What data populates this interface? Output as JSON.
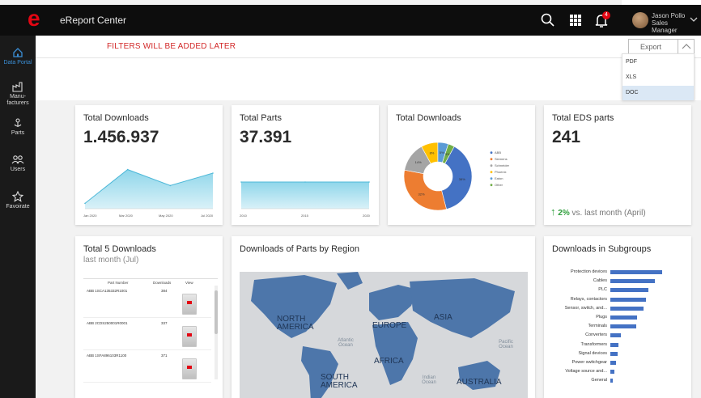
{
  "app": {
    "logo_letter": "e",
    "title": "eReport Center"
  },
  "header": {
    "notification_count": "4",
    "user_name": "Jason Pollo",
    "user_role": "Sales Manager"
  },
  "sidebar": {
    "items": [
      {
        "label": "Data Portal",
        "icon": "home-icon",
        "active": true
      },
      {
        "label": "Manu-facturers",
        "icon": "factory-icon",
        "active": false
      },
      {
        "label": "Parts",
        "icon": "parts-icon",
        "active": false
      },
      {
        "label": "Users",
        "icon": "users-icon",
        "active": false
      },
      {
        "label": "Favoirate",
        "icon": "star-icon",
        "active": false
      }
    ]
  },
  "filters": {
    "notice": "FILTERS WILL BE ADDED LATER"
  },
  "export": {
    "label": "Export",
    "options": [
      "PDF",
      "XLS",
      "DOC"
    ],
    "highlighted": "DOC"
  },
  "cards": {
    "total_downloads": {
      "title": "Total Downloads",
      "value": "1.456.937",
      "x_ticks": [
        "Jan 2020",
        "Mar 2020",
        "May 2020",
        "Jul 2020"
      ]
    },
    "total_parts": {
      "title": "Total Parts",
      "value": "37.391",
      "x_ticks": [
        "2010",
        "2015",
        "2020"
      ]
    },
    "downloads_pie": {
      "title": "Total Downloads",
      "legend": [
        "ABB",
        "Siemens",
        "Schneider",
        "Phoenix",
        "Eaton",
        "Other"
      ]
    },
    "eds_parts": {
      "title": "Total EDS parts",
      "value": "241",
      "change_pct": "2%",
      "change_text": "vs. last month (April)"
    },
    "top5": {
      "title": "Total 5 Downloads",
      "subtitle": "last month (Jul)",
      "columns": [
        "Part Number",
        "Downloads",
        "View"
      ],
      "rows": [
        {
          "part": "ABB 1SCA135332R1001",
          "downloads": "384"
        },
        {
          "part": "ABB 2CDS250001R0001",
          "downloads": "337"
        },
        {
          "part": "ABB 1SFA896103R1100",
          "downloads": "371"
        }
      ]
    },
    "map": {
      "title": "Downloads of Parts by Region",
      "regions": [
        "NORTH AMERICA",
        "EUROPE",
        "ASIA",
        "AFRICA",
        "SOUTH AMERICA",
        "AUSTRALIA"
      ],
      "oceans": [
        "Atlantic Ocean",
        "Pacific Ocean",
        "Indian Ocean"
      ]
    },
    "subgroups": {
      "title": "Downloads in Subgroups"
    }
  },
  "colors": {
    "brand_red": "#e30613",
    "accent_blue": "#3b8fd6",
    "area_fill": "#8fd6ea",
    "bar_blue": "#4472c4",
    "positive_green": "#2e9e3b"
  },
  "chart_data": [
    {
      "type": "area",
      "title": "Total Downloads",
      "x": [
        "Jan 2020",
        "Mar 2020",
        "May 2020",
        "Jul 2020"
      ],
      "values": [
        6,
        44,
        26,
        40
      ],
      "ylim": [
        0,
        60
      ]
    },
    {
      "type": "area",
      "title": "Total Parts",
      "x": [
        "2010",
        "2015",
        "2020"
      ],
      "values": [
        30,
        30,
        30
      ],
      "ylim": [
        0,
        60
      ]
    },
    {
      "type": "pie",
      "title": "Total Downloads",
      "donut": true,
      "categories": [
        "ABB",
        "Siemens",
        "Schneider",
        "Phoenix",
        "Eaton",
        "Other"
      ],
      "values": [
        38,
        32,
        14,
        8,
        5,
        3
      ],
      "slice_labels": [
        "38%",
        "32%",
        "14%",
        "8%",
        "5%",
        "3%"
      ],
      "colors": [
        "#4472c4",
        "#ed7d31",
        "#a5a5a5",
        "#ffc000",
        "#5b9bd5",
        "#70ad47"
      ]
    },
    {
      "type": "bar",
      "orientation": "horizontal",
      "title": "Downloads in Subgroups",
      "categories": [
        "Protection devices",
        "Cables",
        "PLC",
        "Relays, contactors",
        "Sensor, switch, and...",
        "Plugs",
        "Terminals",
        "Converters",
        "Transformers",
        "Signal devices",
        "Power switchgear",
        "Voltage source and...",
        "General"
      ],
      "values": [
        100,
        86,
        74,
        68,
        64,
        52,
        50,
        20,
        16,
        14,
        11,
        8,
        5
      ],
      "xlim": [
        0,
        100
      ]
    }
  ]
}
